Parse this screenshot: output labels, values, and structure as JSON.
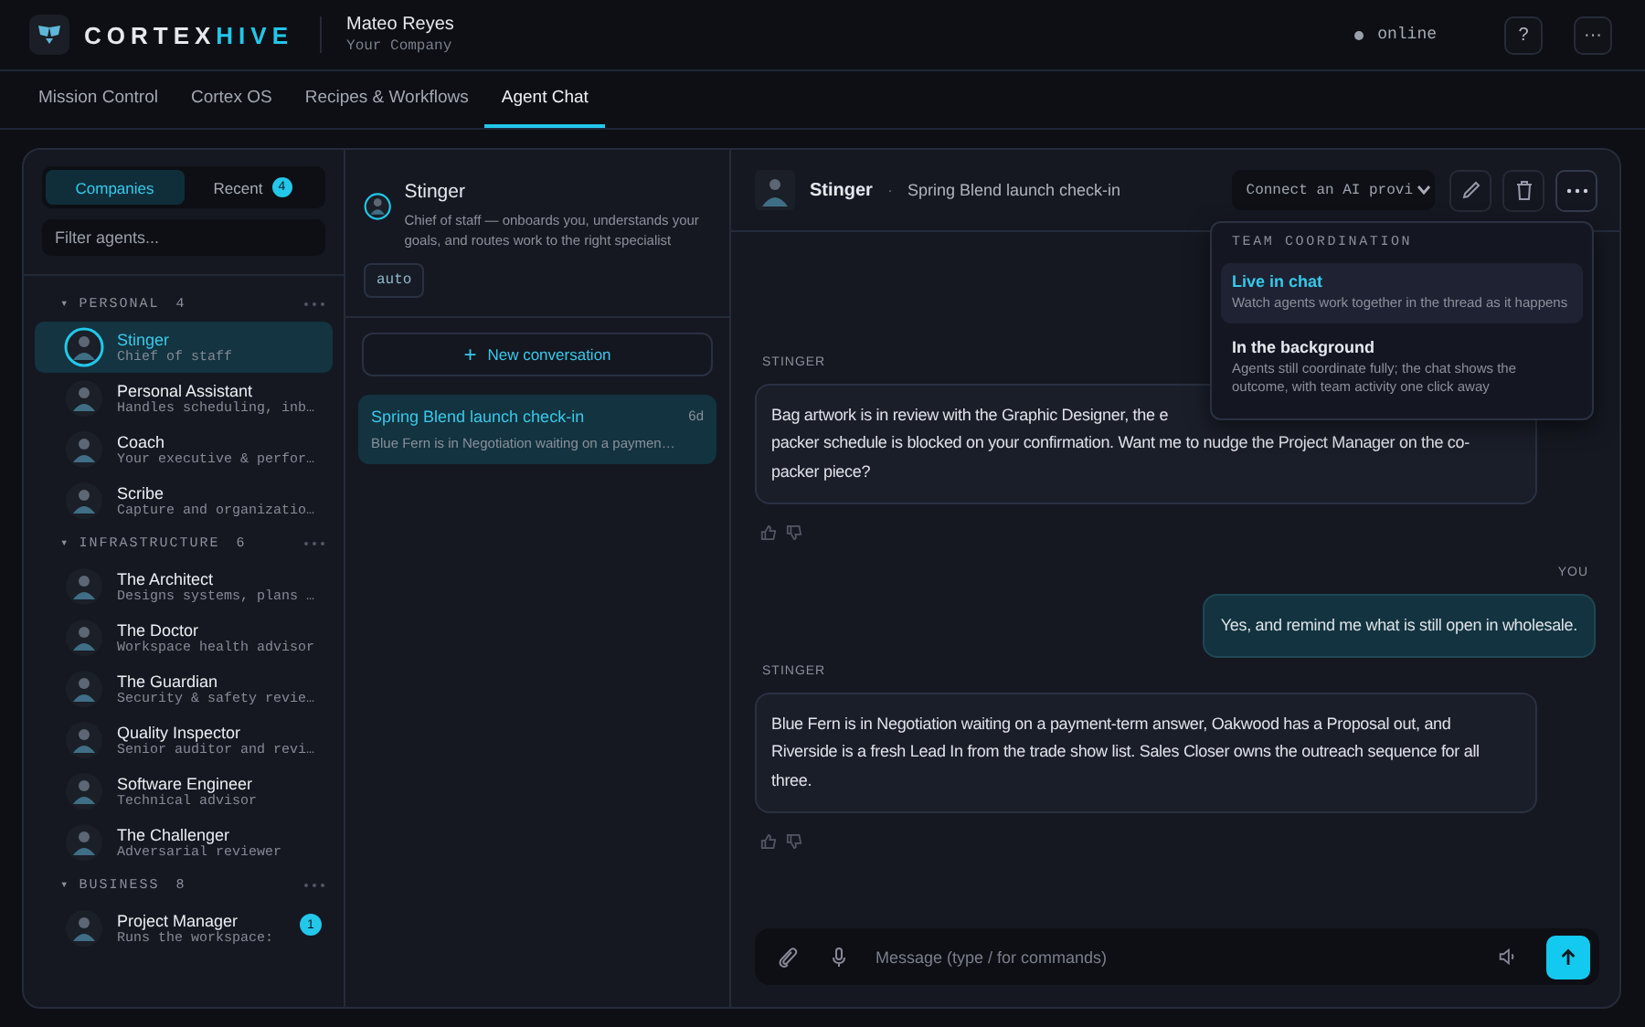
{
  "brand": {
    "left": "CORTEX",
    "right": "HIVE"
  },
  "user": {
    "name": "Mateo Reyes",
    "company": "Your Company"
  },
  "status": {
    "label": "online"
  },
  "header_buttons": [
    "?",
    "···"
  ],
  "tabs": [
    {
      "label": "Mission Control",
      "selected": false
    },
    {
      "label": "Cortex OS",
      "selected": false
    },
    {
      "label": "Recipes & Workflows",
      "selected": false
    },
    {
      "label": "Agent Chat",
      "selected": true
    }
  ],
  "sidebar": {
    "segments": [
      {
        "label": "Companies",
        "selected": true
      },
      {
        "label": "Recent",
        "selected": false,
        "badge": "4"
      }
    ],
    "filter": {
      "placeholder": "Filter agents..."
    },
    "groups": [
      {
        "name": "PERSONAL",
        "caret": "▾",
        "count": "4",
        "items": [
          {
            "name": "Stinger",
            "role": "Chief of staff",
            "selected": true
          },
          {
            "name": "Personal Assistant",
            "role": "Handles scheduling, inb…",
            "selected": false
          },
          {
            "name": "Coach",
            "role": "Your executive & perfor…",
            "selected": false
          },
          {
            "name": "Scribe",
            "role": "Capture and organizatio…",
            "selected": false
          }
        ]
      },
      {
        "name": "INFRASTRUCTURE",
        "caret": "▾",
        "count": "6",
        "items": [
          {
            "name": "The Architect",
            "role": "Designs systems, plans …",
            "selected": false
          },
          {
            "name": "The Doctor",
            "role": "Workspace health advisor",
            "selected": false
          },
          {
            "name": "The Guardian",
            "role": "Security & safety revie…",
            "selected": false
          },
          {
            "name": "Quality Inspector",
            "role": "Senior auditor and revi…",
            "selected": false
          },
          {
            "name": "Software Engineer",
            "role": "Technical advisor",
            "selected": false
          },
          {
            "name": "The Challenger",
            "role": "Adversarial reviewer",
            "selected": false
          }
        ]
      },
      {
        "name": "BUSINESS",
        "caret": "▾",
        "count": "8",
        "items": [
          {
            "name": "Project Manager",
            "role": "Runs the workspace:",
            "selected": false,
            "badge": "1"
          }
        ]
      }
    ]
  },
  "agent": {
    "name": "Stinger",
    "description": "Chief of staff — onboards you, understands your goals, and routes work to the right specialist",
    "tag": "auto"
  },
  "new_conversation": {
    "icon": "+",
    "label": "New conversation"
  },
  "conversations": [
    {
      "title": "Spring Blend launch check-in",
      "age": "6d",
      "preview": "Blue Fern is in Negotiation waiting on a paymen…",
      "selected": true
    }
  ],
  "chat": {
    "agent": "Stinger",
    "separator": "·",
    "title": "Spring Blend launch check-in",
    "provider": "Connect an AI provi",
    "messages": [
      {
        "kind": "agent",
        "sender": "STINGER",
        "lines": [
          "Bag artwork is in review with the Graphic Designer, the e",
          "packer schedule is blocked on your confirmation. Want me to nudge the Project Manager on the co-",
          "packer piece?"
        ]
      },
      {
        "kind": "user",
        "sender": "YOU",
        "lines": [
          "Yes, and remind me what is still open in wholesale."
        ]
      },
      {
        "kind": "agent",
        "sender": "STINGER",
        "lines": [
          "Blue Fern is in Negotiation waiting on a payment-term answer, Oakwood has a Proposal out, and Riverside is a fresh Lead In from the trade show list. Sales Closer owns the outreach sequence for all three."
        ]
      }
    ],
    "composer": {
      "placeholder": "Message (type / for commands)"
    },
    "menu": {
      "title": "TEAM COORDINATION",
      "options": [
        {
          "label": "Live in chat",
          "description": "Watch agents work together in the thread as it happens",
          "selected": true
        },
        {
          "label": "In the background",
          "description": "Agents still coordinate fully; the chat shows the outcome, with team activity one click away",
          "selected": false
        }
      ]
    }
  }
}
